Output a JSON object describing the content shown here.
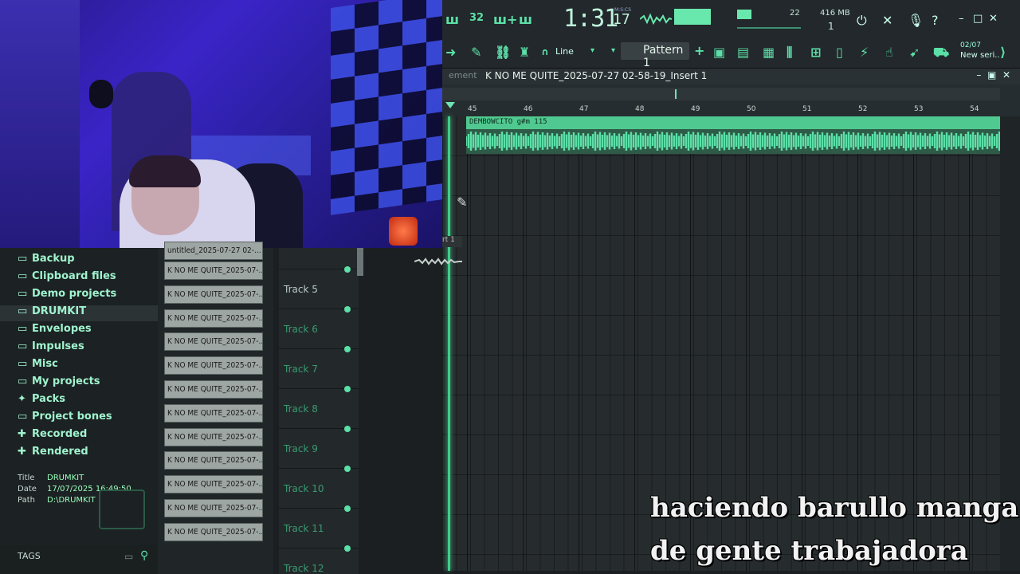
{
  "toolbar": {
    "time_main": "1:31",
    "time_sub": "17",
    "time_units": "M:S:CS",
    "cpu": "22",
    "memory": "416 MB",
    "polyphony": "1",
    "snap_mode": "Line",
    "pattern": "Pattern 1",
    "song_date": "02/07",
    "song_name": "New seri.."
  },
  "playlist": {
    "side_label": "ement",
    "title": "K NO ME QUITE_2025-07-27 02-58-19_Insert 1",
    "bar_numbers": [
      "45",
      "46",
      "47",
      "48",
      "49",
      "50",
      "51",
      "52",
      "53",
      "54"
    ],
    "clip_label": "DEMBOWCITO g#m 115",
    "part_label": "rt 1"
  },
  "browser": {
    "folders": [
      {
        "label": "Backup",
        "icon": "folder-icon"
      },
      {
        "label": "Clipboard files",
        "icon": "folder-icon"
      },
      {
        "label": "Demo projects",
        "icon": "folder-icon"
      },
      {
        "label": "DRUMKIT",
        "icon": "folder-icon"
      },
      {
        "label": "Envelopes",
        "icon": "folder-icon"
      },
      {
        "label": "Impulses",
        "icon": "folder-icon"
      },
      {
        "label": "Misc",
        "icon": "folder-icon"
      },
      {
        "label": "My projects",
        "icon": "folder-icon"
      },
      {
        "label": "Packs",
        "icon": "packs-icon"
      },
      {
        "label": "Project bones",
        "icon": "folder-icon"
      },
      {
        "label": "Recorded",
        "icon": "plus-icon"
      },
      {
        "label": "Rendered",
        "icon": "plus-icon"
      }
    ],
    "info": {
      "title_key": "Title",
      "title_val": "DRUMKIT",
      "date_key": "Date",
      "date_val": "17/07/2025 16:49:50",
      "path_key": "Path",
      "path_val": "D:\\DRUMKIT"
    },
    "tags": "TAGS"
  },
  "files": {
    "top_partial": "untitled_2025-07-27 02-...",
    "items": [
      "K NO ME QUITE_2025-07-...",
      "K NO ME QUITE_2025-07-...",
      "K NO ME QUITE_2025-07-...",
      "K NO ME QUITE_2025-07-...",
      "K NO ME QUITE_2025-07-...",
      "K NO ME QUITE_2025-07-...",
      "K NO ME QUITE_2025-07-...",
      "K NO ME QUITE_2025-07-...",
      "K NO ME QUITE_2025-07-...",
      "K NO ME QUITE_2025-07-...",
      "K NO ME QUITE_2025-07-...",
      "K NO ME QUITE_2025-07-..."
    ]
  },
  "tracks": [
    "Track 5",
    "Track 6",
    "Track 7",
    "Track 8",
    "Track 9",
    "Track 10",
    "Track 11",
    "Track 12"
  ],
  "subtitle": {
    "line1": "haciendo barullo manga",
    "line2": "de gente trabajadora"
  },
  "colors": {
    "accent": "#5ce0a8",
    "clip": "#4fc98f",
    "grid": "#262c2e"
  }
}
